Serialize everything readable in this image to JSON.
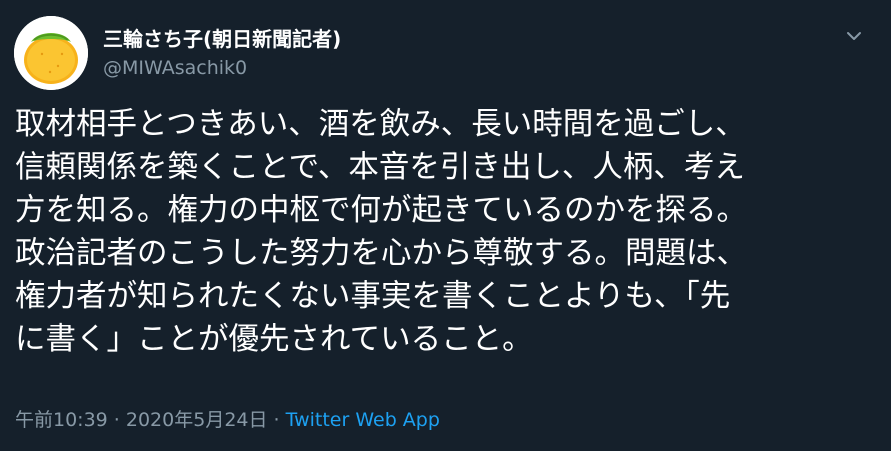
{
  "tweet": {
    "author": {
      "display_name": "三輪さち子(朝日新聞記者)",
      "handle": "@MIWAsachik0",
      "avatar_icon": "orange-fruit-icon"
    },
    "menu_icon": "chevron-down-icon",
    "text_lines": [
      "取材相手とつきあい、酒を飲み、長い時間を過ごし、",
      "信頼関係を築くことで、本音を引き出し、人柄、考え",
      "方を知る。権力の中枢で何が起きているのかを探る。",
      "政治記者のこうした努力を心から尊敬する。問題は、",
      "権力者が知られたくない事実を書くことよりも、「先",
      "に書く」ことが優先されていること。"
    ],
    "timestamp": "午前10:39 · 2020年5月24日",
    "separator": " · ",
    "source": "Twitter Web App"
  },
  "colors": {
    "background": "#15202b",
    "text_primary": "#ffffff",
    "text_secondary": "#8899a6",
    "link": "#1da1f2"
  }
}
